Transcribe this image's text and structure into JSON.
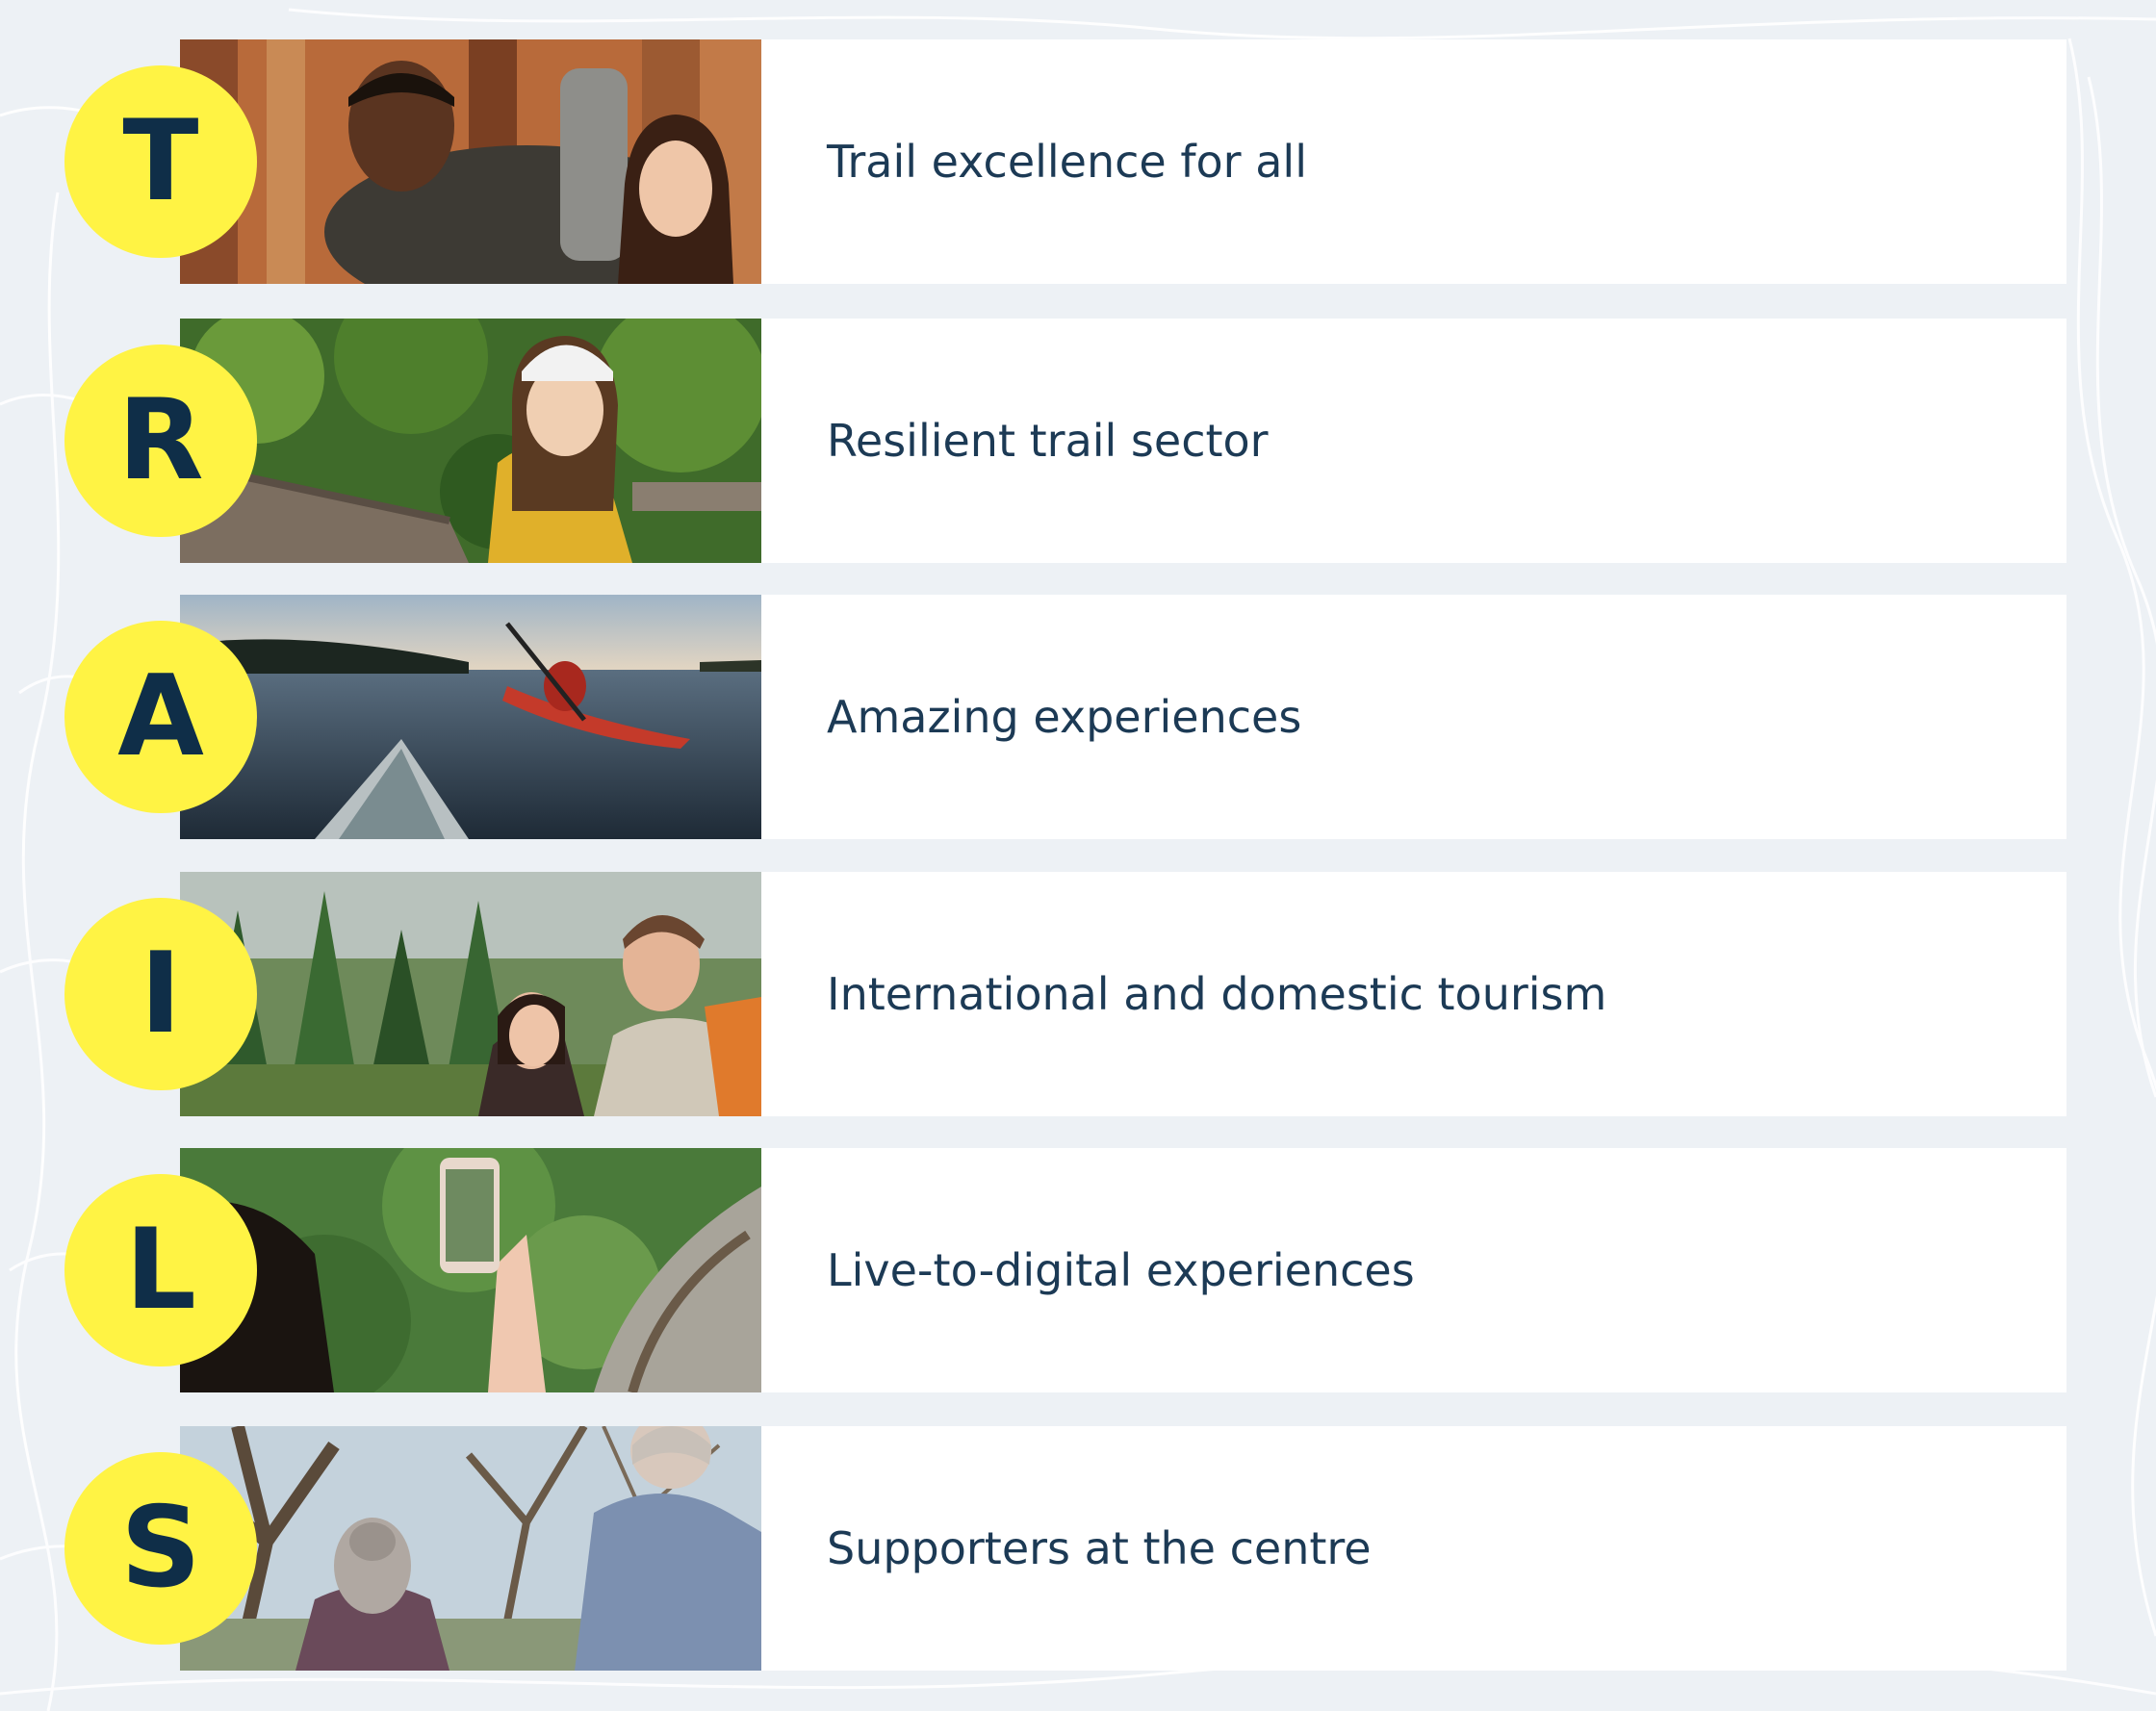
{
  "colors": {
    "background": "#edf1f5",
    "panel": "#ffffff",
    "badge": "#fff344",
    "letter": "#0f2e48",
    "text": "#1c3a55"
  },
  "rows": [
    {
      "letter": "T",
      "text": "Trail excellence for all",
      "photo_icon": "hikers-photo"
    },
    {
      "letter": "R",
      "text": "Resilient trail sector",
      "photo_icon": "trail-worker-photo"
    },
    {
      "letter": "A",
      "text": "Amazing experiences",
      "photo_icon": "kayak-photo"
    },
    {
      "letter": "I",
      "text": "International and domestic tourism",
      "photo_icon": "tourists-photo"
    },
    {
      "letter": "L",
      "text": "Live-to-digital experiences",
      "photo_icon": "phone-photo"
    },
    {
      "letter": "S",
      "text": "Supporters at the centre",
      "photo_icon": "supporters-photo"
    }
  ]
}
